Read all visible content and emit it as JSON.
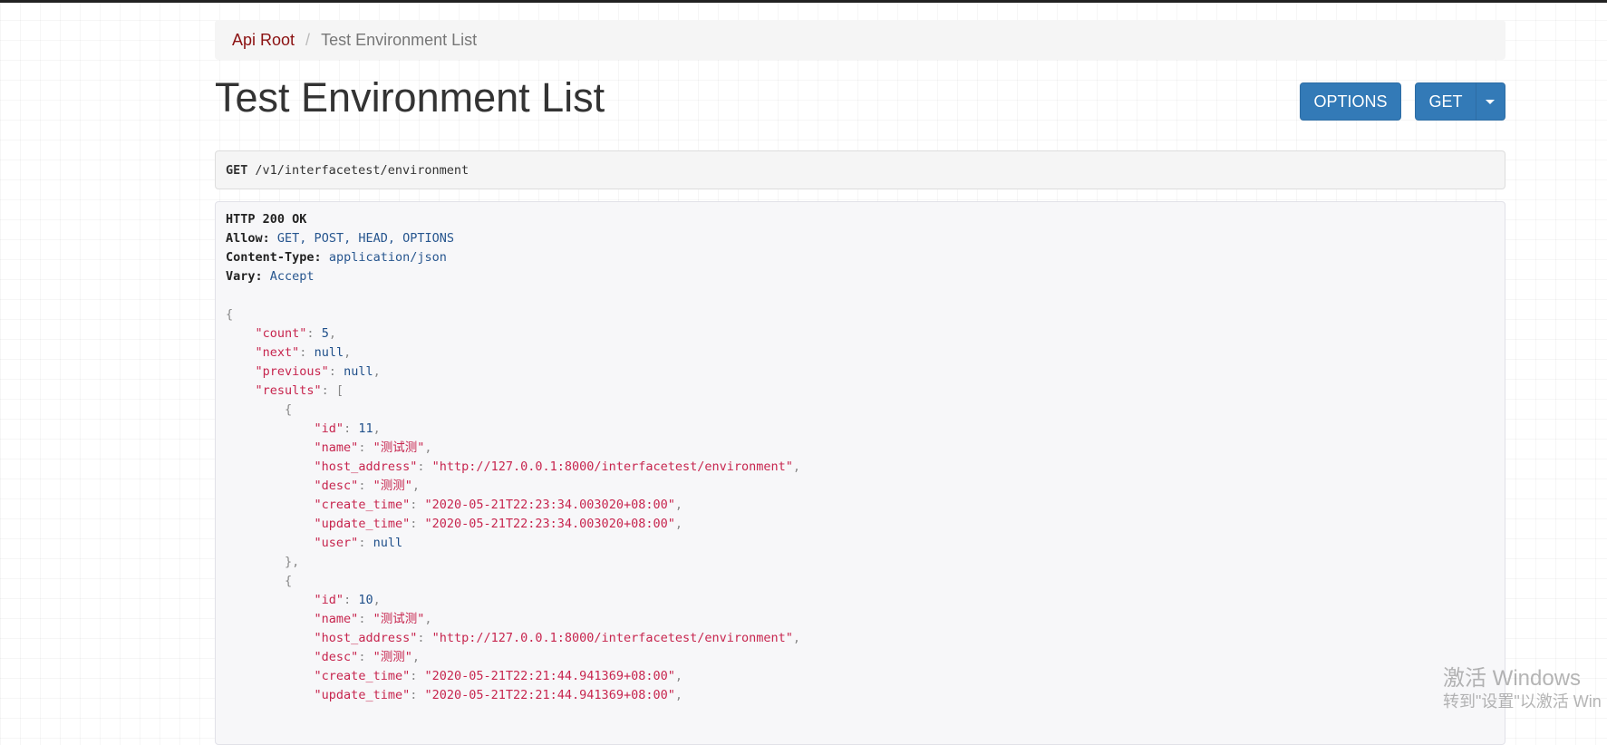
{
  "breadcrumb": {
    "root": "Api Root",
    "separator": "/",
    "current": "Test Environment List"
  },
  "page_title": "Test Environment List",
  "buttons": {
    "options": "OPTIONS",
    "get": "GET"
  },
  "request": {
    "method": "GET",
    "path": "/v1/interfacetest/environment"
  },
  "response": {
    "status": "HTTP 200 OK",
    "headers": [
      {
        "key": "Allow:",
        "value": "GET, POST, HEAD, OPTIONS"
      },
      {
        "key": "Content-Type:",
        "value": "application/json"
      },
      {
        "key": "Vary:",
        "value": "Accept"
      }
    ],
    "body": {
      "count": 5,
      "next": "null",
      "previous": "null",
      "results": [
        {
          "id": 11,
          "name": "测试测",
          "host_address": "http://127.0.0.1:8000/interfacetest/environment",
          "desc": "测测",
          "create_time": "2020-05-21T22:23:34.003020+08:00",
          "update_time": "2020-05-21T22:23:34.003020+08:00",
          "user": "null"
        },
        {
          "id": 10,
          "name": "测试测",
          "host_address": "http://127.0.0.1:8000/interfacetest/environment",
          "desc": "测测",
          "create_time": "2020-05-21T22:21:44.941369+08:00",
          "update_time": "2020-05-21T22:21:44.941369+08:00"
        }
      ]
    }
  },
  "watermark": {
    "title": "激活 Windows",
    "subtitle": "转到\"设置\"以激活 Win"
  }
}
